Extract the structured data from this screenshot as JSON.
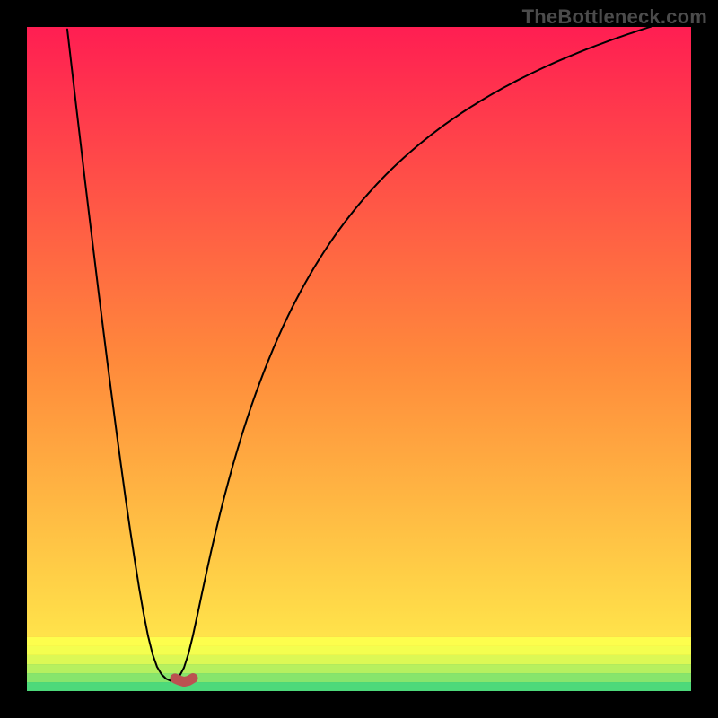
{
  "watermark": "TheBottleneck.com",
  "chart_data": {
    "type": "line",
    "title": "",
    "xlabel": "",
    "ylabel": "",
    "xlim": [
      0,
      100
    ],
    "ylim": [
      0,
      100
    ],
    "series": [
      {
        "name": "curve",
        "color": "#000000",
        "width": 2,
        "x": [
          6.08,
          6.76,
          7.43,
          8.11,
          8.78,
          9.46,
          10.14,
          10.81,
          11.49,
          12.16,
          12.84,
          13.51,
          14.19,
          14.86,
          15.54,
          16.22,
          16.89,
          17.57,
          18.24,
          18.92,
          19.59,
          20.27,
          20.95,
          21.62,
          22.3,
          22.97,
          23.65,
          24.32,
          25.0,
          25.68,
          26.35,
          27.03,
          27.7,
          28.38,
          29.05,
          29.73,
          30.41,
          31.08,
          31.76,
          32.43,
          33.11,
          33.78,
          34.46,
          35.14,
          35.81,
          36.49,
          37.16,
          37.84,
          38.51,
          39.19,
          39.86,
          40.54,
          41.22,
          41.89,
          42.57,
          43.24,
          43.92,
          44.59,
          45.27,
          45.95,
          46.62,
          47.3,
          47.97,
          48.65,
          49.32,
          50.0,
          50.68,
          51.35,
          52.03,
          52.7,
          53.38,
          54.05,
          54.73,
          55.41,
          56.08,
          56.76,
          57.43,
          58.11,
          58.78,
          59.46,
          60.14,
          60.81,
          61.49,
          62.16,
          62.84,
          63.51,
          64.19,
          64.86,
          65.54,
          66.22,
          66.89,
          67.57,
          68.24,
          68.92,
          69.59,
          70.27,
          70.95,
          71.62,
          72.3,
          72.97,
          73.65,
          74.32,
          75.0,
          75.68,
          76.35,
          77.03,
          77.7,
          78.38,
          79.05,
          79.73,
          80.41,
          81.08,
          81.76,
          82.43,
          83.11,
          83.78,
          84.46,
          85.14,
          85.81,
          86.49,
          87.16,
          87.84,
          88.51,
          89.19,
          89.86,
          90.54,
          91.22,
          91.89,
          92.57,
          93.24,
          93.92,
          94.59,
          95.27,
          95.95,
          96.62,
          97.3,
          97.97,
          98.65,
          99.32,
          100.0
        ],
        "y": [
          99.64,
          93.8,
          88.01,
          82.27,
          76.58,
          70.96,
          65.4,
          59.91,
          54.5,
          49.18,
          43.95,
          38.83,
          33.83,
          28.97,
          24.28,
          19.8,
          15.57,
          11.69,
          8.29,
          5.55,
          3.65,
          2.52,
          1.86,
          1.56,
          1.66,
          2.26,
          3.53,
          5.61,
          8.38,
          11.52,
          14.71,
          17.85,
          20.89,
          23.81,
          26.61,
          29.29,
          31.83,
          34.26,
          36.57,
          38.78,
          40.89,
          42.9,
          44.83,
          46.67,
          48.43,
          50.12,
          51.74,
          53.29,
          54.79,
          56.22,
          57.6,
          58.92,
          60.2,
          61.43,
          62.62,
          63.76,
          64.87,
          65.93,
          66.96,
          67.96,
          68.92,
          69.85,
          70.75,
          71.62,
          72.47,
          73.29,
          74.09,
          74.86,
          75.61,
          76.34,
          77.05,
          77.74,
          78.41,
          79.06,
          79.7,
          80.32,
          80.92,
          81.51,
          82.08,
          82.64,
          83.18,
          83.72,
          84.23,
          84.74,
          85.24,
          85.72,
          86.19,
          86.65,
          87.11,
          87.55,
          87.98,
          88.4,
          88.82,
          89.22,
          89.62,
          90.01,
          90.39,
          90.77,
          91.13,
          91.49,
          91.85,
          92.19,
          92.53,
          92.87,
          93.19,
          93.51,
          93.83,
          94.14,
          94.45,
          94.75,
          95.04,
          95.33,
          95.62,
          95.89,
          96.17,
          96.44,
          96.71,
          96.97,
          97.23,
          97.48,
          97.73,
          97.98,
          98.22,
          98.46,
          98.69,
          98.93,
          99.15,
          99.38,
          99.6,
          99.82,
          100.04,
          100.25,
          100.46,
          100.67,
          100.87,
          101.07,
          101.27,
          101.47,
          101.66,
          101.85
        ]
      },
      {
        "name": "highlight",
        "color": "#bb5251",
        "width": 11,
        "x": [
          22.3,
          22.97,
          23.65,
          24.32,
          25.0
        ],
        "y": [
          1.9,
          1.6,
          1.4,
          1.55,
          1.95
        ]
      }
    ],
    "bands": [
      {
        "y0": 0.0,
        "y1": 1.35,
        "color": "#4dd97a"
      },
      {
        "y0": 1.35,
        "y1": 2.7,
        "color": "#87e56c"
      },
      {
        "y0": 2.7,
        "y1": 4.05,
        "color": "#b6f05f"
      },
      {
        "y0": 4.05,
        "y1": 5.41,
        "color": "#dcf855"
      },
      {
        "y0": 5.41,
        "y1": 6.76,
        "color": "#f4fe4f"
      },
      {
        "y0": 6.76,
        "y1": 8.11,
        "color": "#fdfe4d"
      },
      {
        "y0": 8.11,
        "y1": 100.0,
        "color": "gradient"
      }
    ],
    "gradient_top": "#ff1e52",
    "gradient_mid": "#ff8a3b",
    "gradient_low": "#ffe34a"
  }
}
